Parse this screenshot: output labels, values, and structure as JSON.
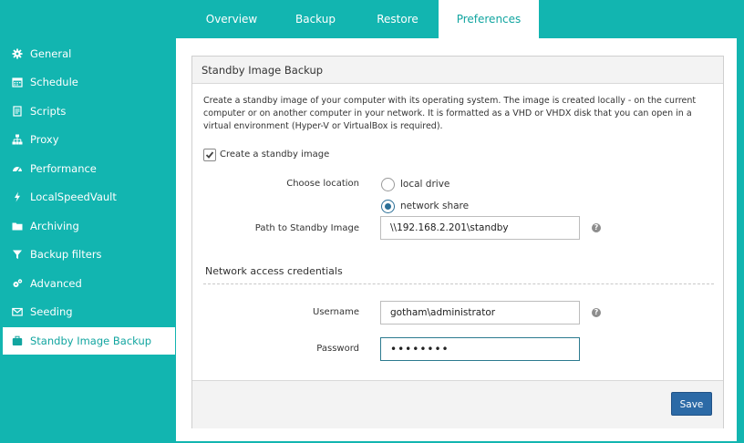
{
  "tabs": [
    {
      "label": "Overview",
      "active": false
    },
    {
      "label": "Backup",
      "active": false
    },
    {
      "label": "Restore",
      "active": false
    },
    {
      "label": "Preferences",
      "active": true
    }
  ],
  "sidebar": {
    "items": [
      {
        "label": "General",
        "icon": "gear-icon"
      },
      {
        "label": "Schedule",
        "icon": "calendar-icon"
      },
      {
        "label": "Scripts",
        "icon": "document-icon"
      },
      {
        "label": "Proxy",
        "icon": "network-icon"
      },
      {
        "label": "Performance",
        "icon": "gauge-icon"
      },
      {
        "label": "LocalSpeedVault",
        "icon": "lightning-icon"
      },
      {
        "label": "Archiving",
        "icon": "folder-icon"
      },
      {
        "label": "Backup filters",
        "icon": "filter-icon"
      },
      {
        "label": "Advanced",
        "icon": "gears-icon"
      },
      {
        "label": "Seeding",
        "icon": "envelope-icon"
      },
      {
        "label": "Standby Image Backup",
        "icon": "briefcase-icon",
        "active": true
      }
    ]
  },
  "panel": {
    "title": "Standby Image Backup",
    "description": "Create a standby image of your computer with its operating system. The image is created locally - on the current computer or on another computer in your network. It is formatted as a VHD or VHDX disk that you can open in a virtual environment (Hyper-V or VirtualBox is required).",
    "create_checkbox": {
      "label": "Create a standby image",
      "checked": true
    },
    "location": {
      "label": "Choose location",
      "options": [
        {
          "label": "local drive",
          "selected": false
        },
        {
          "label": "network share",
          "selected": true
        }
      ]
    },
    "path": {
      "label": "Path to Standby Image",
      "value": "\\\\192.168.2.201\\standby"
    },
    "credentials": {
      "section_label": "Network access credentials",
      "username": {
        "label": "Username",
        "value": "gotham\\administrator"
      },
      "password": {
        "label": "Password",
        "value": "••••••••"
      }
    },
    "save_label": "Save"
  },
  "colors": {
    "accent": "#12b5b0",
    "button": "#2c6aa6",
    "radio_selected": "#2b6f97"
  }
}
